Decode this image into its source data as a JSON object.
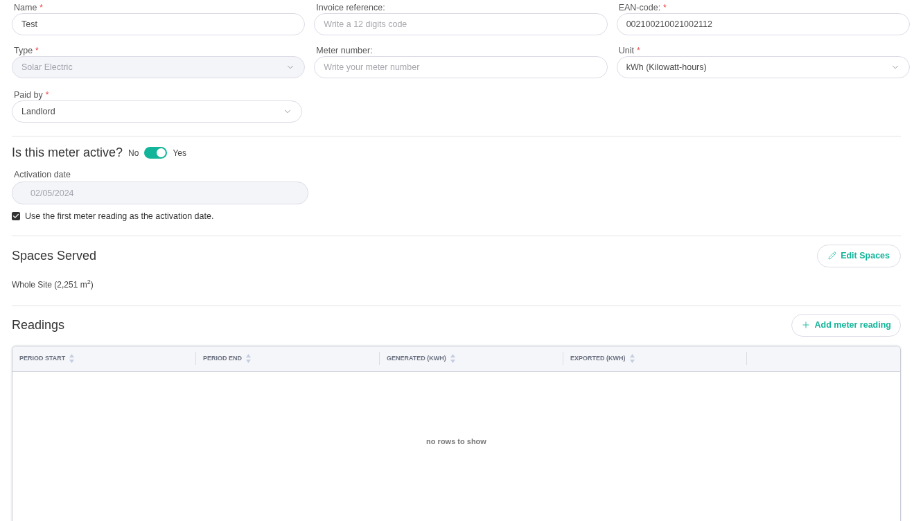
{
  "fields": [
    {
      "label": "Name",
      "required_mark": "*",
      "kind": "text",
      "value": "Test",
      "disabled": false
    },
    {
      "label": "Invoice reference:",
      "kind": "text",
      "placeholder": "Write a 12 digits code",
      "disabled": false
    },
    {
      "label": "EAN-code:",
      "required_mark": "*",
      "kind": "text",
      "value": "002100210021002112",
      "disabled": false
    },
    {
      "label": "Type",
      "required_mark": "*",
      "kind": "select",
      "value": "Solar Electric",
      "disabled": true
    },
    {
      "label": "Meter number:",
      "kind": "text",
      "placeholder": "Write your meter number",
      "disabled": false
    },
    {
      "label": "Unit",
      "required_mark": "*",
      "kind": "select",
      "value": "kWh (Kilowatt-hours)",
      "disabled": false
    },
    {
      "label": "Paid by",
      "required_mark": "*",
      "kind": "select",
      "value": "Landlord",
      "disabled": false
    }
  ],
  "activity": {
    "question": "Is this meter active?",
    "off_label": "No",
    "on_label": "Yes",
    "on": true,
    "date_label": "Activation date",
    "date_value": "02/05/2024",
    "date_disabled": true,
    "checkbox_label": "Use the first meter reading as the activation date.",
    "checked": true
  },
  "spaces": {
    "title": "Spaces Served",
    "button": "Edit Spaces",
    "text": "Whole Site (2,251 m$^{2}$)"
  },
  "readings": {
    "title": "Readings",
    "button": "Add meter reading",
    "columns": [
      {
        "label": "PERIOD START",
        "sortable": true
      },
      {
        "label": "PERIOD END",
        "sortable": true
      },
      {
        "label": "GENERATED (KWH)",
        "sortable": true
      },
      {
        "label": "EXPORTED (KWH)",
        "sortable": true
      }
    ],
    "empty": "no rows to show"
  }
}
